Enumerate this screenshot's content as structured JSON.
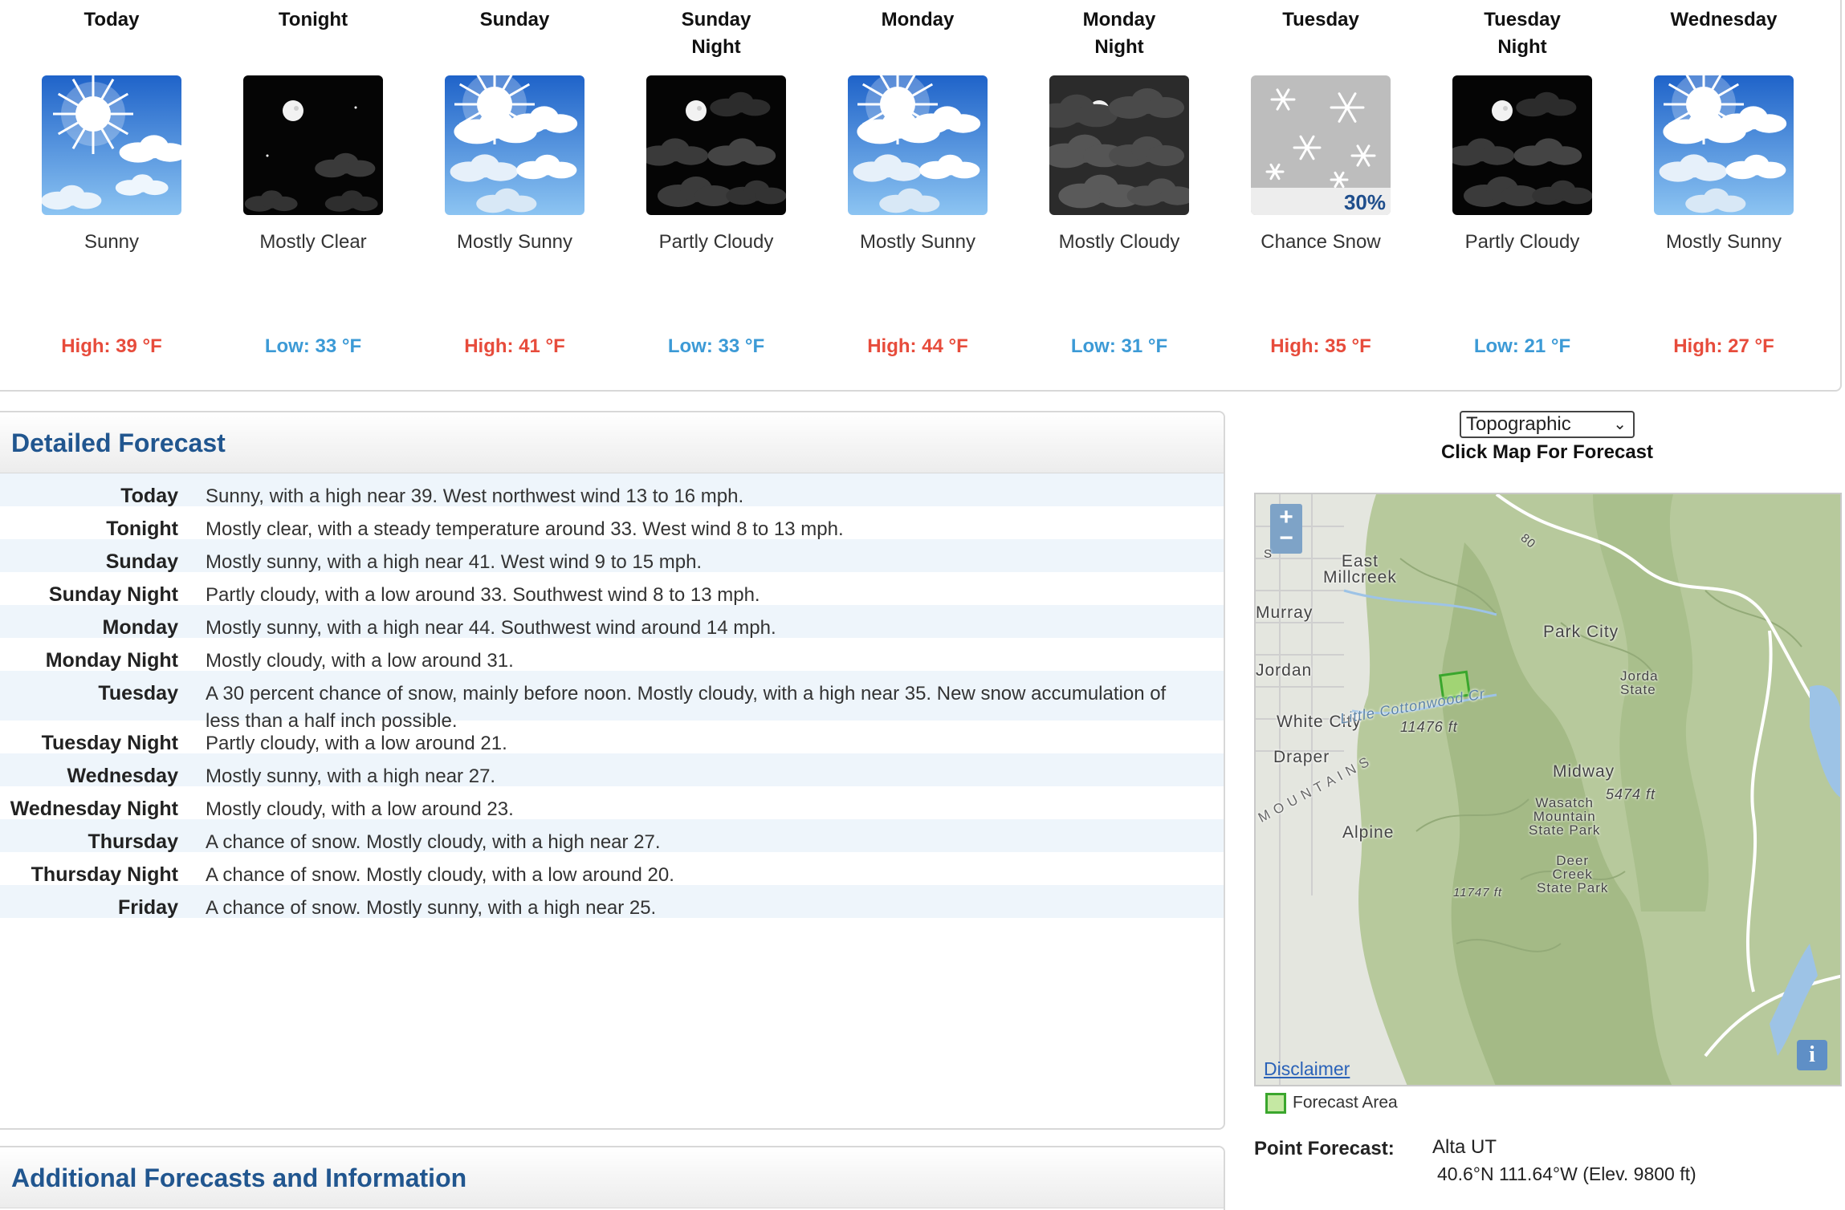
{
  "forecast_strip": {
    "periods": [
      {
        "name": "Today",
        "icon": "sunny-icon",
        "short": "Sunny",
        "temp": "High: 39 °F",
        "kind": "high"
      },
      {
        "name": "Tonight",
        "icon": "night-clear-icon",
        "short": "Mostly Clear",
        "temp": "Low: 33 °F",
        "kind": "low"
      },
      {
        "name": "Sunday",
        "icon": "mostly-sunny-icon",
        "short": "Mostly Sunny",
        "temp": "High: 41 °F",
        "kind": "high"
      },
      {
        "name": "Sunday\nNight",
        "icon": "night-partly-cloudy-icon",
        "short": "Partly Cloudy",
        "temp": "Low: 33 °F",
        "kind": "low"
      },
      {
        "name": "Monday",
        "icon": "mostly-sunny-icon",
        "short": "Mostly Sunny",
        "temp": "High: 44 °F",
        "kind": "high"
      },
      {
        "name": "Monday\nNight",
        "icon": "night-mostly-cloudy-icon",
        "short": "Mostly Cloudy",
        "temp": "Low: 31 °F",
        "kind": "low"
      },
      {
        "name": "Tuesday",
        "icon": "snow-icon",
        "short": "Chance Snow",
        "temp": "High: 35 °F",
        "kind": "high",
        "pop": "30%"
      },
      {
        "name": "Tuesday\nNight",
        "icon": "night-partly-cloudy-icon",
        "short": "Partly Cloudy",
        "temp": "Low: 21 °F",
        "kind": "low"
      },
      {
        "name": "Wednesday",
        "icon": "mostly-sunny-icon",
        "short": "Mostly Sunny",
        "temp": "High: 27 °F",
        "kind": "high"
      }
    ]
  },
  "detailed": {
    "title": "Detailed Forecast",
    "rows": [
      {
        "label": "Today",
        "text": "Sunny, with a high near 39. West northwest wind 13 to 16 mph."
      },
      {
        "label": "Tonight",
        "text": "Mostly clear, with a steady temperature around 33. West wind 8 to 13 mph."
      },
      {
        "label": "Sunday",
        "text": "Mostly sunny, with a high near 41. West wind 9 to 15 mph."
      },
      {
        "label": "Sunday Night",
        "text": "Partly cloudy, with a low around 33. Southwest wind 8 to 13 mph."
      },
      {
        "label": "Monday",
        "text": "Mostly sunny, with a high near 44. Southwest wind around 14 mph."
      },
      {
        "label": "Monday Night",
        "text": "Mostly cloudy, with a low around 31."
      },
      {
        "label": "Tuesday",
        "text": "A 30 percent chance of snow, mainly before noon. Mostly cloudy, with a high near 35. New snow accumulation of less than a half inch possible."
      },
      {
        "label": "Tuesday Night",
        "text": "Partly cloudy, with a low around 21."
      },
      {
        "label": "Wednesday",
        "text": "Mostly sunny, with a high near 27."
      },
      {
        "label": "Wednesday Night",
        "text": "Mostly cloudy, with a low around 23."
      },
      {
        "label": "Thursday",
        "text": "A chance of snow. Mostly cloudy, with a high near 27."
      },
      {
        "label": "Thursday Night",
        "text": "A chance of snow. Mostly cloudy, with a low around 20."
      },
      {
        "label": "Friday",
        "text": "A chance of snow. Mostly sunny, with a high near 25."
      }
    ]
  },
  "additional": {
    "title": "Additional Forecasts and Information"
  },
  "map": {
    "type_selected": "Topographic",
    "caption": "Click Map For Forecast",
    "zoom_in": "+",
    "zoom_out": "−",
    "labels": {
      "east_millcreek": "East\nMillcreek",
      "murray": "Murray",
      "jordan": "Jordan",
      "white_city": "White City",
      "draper": "Draper",
      "alpine": "Alpine",
      "park_city": "Park City",
      "midway": "Midway",
      "wasatch": "Wasatch\nMountain\nState Park",
      "deer_creek": "Deer\nCreek\nState Park",
      "jordanelle": "Jorda\nState",
      "little_cottonwood": "Little Cottonwood Cr",
      "elev_11476": "11476 ft",
      "elev_5474": "5474 ft",
      "elev_11747": "11747 ft",
      "mountains": "M O U N T A I N S",
      "hwy_80": "80",
      "hwy_s": "S"
    },
    "disclaimer": "Disclaimer",
    "info": "i",
    "legend": "Forecast Area"
  },
  "point_forecast": {
    "label": "Point Forecast:",
    "place": "Alta UT",
    "coords": "40.6°N 111.64°W (Elev. 9800 ft)"
  },
  "colors": {
    "high": "#e74c3c",
    "low": "#3c9ad6",
    "heading": "#21568f",
    "row_alt": "#eef5fb"
  }
}
